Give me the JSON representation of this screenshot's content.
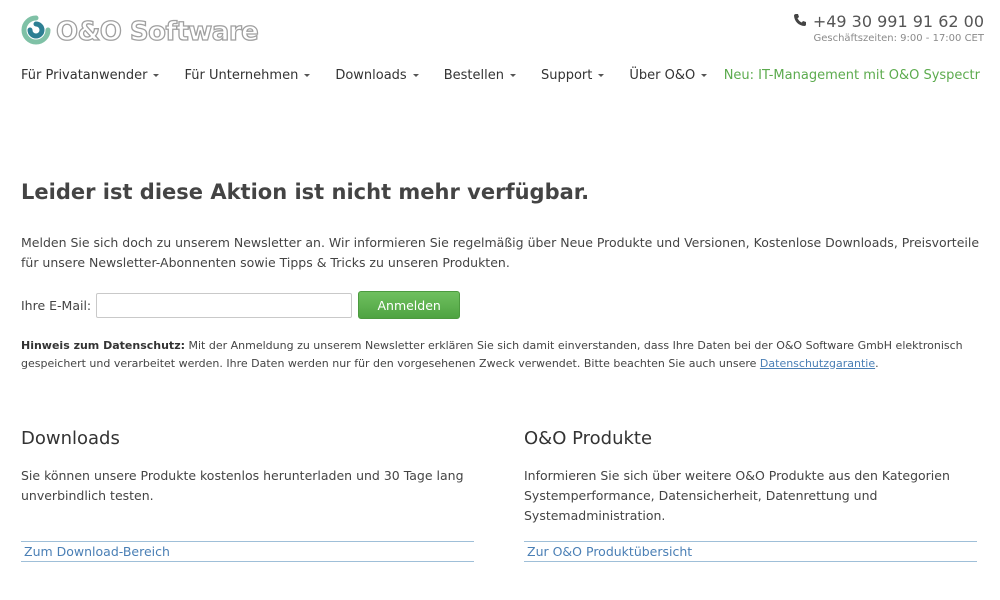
{
  "header": {
    "logo_text": "O&O Software",
    "phone": "+49 30 991 91 62 00",
    "hours": "Geschäftszeiten: 9:00 - 17:00 CET"
  },
  "nav": {
    "items": [
      "Für Privatanwender",
      "Für Unternehmen",
      "Downloads",
      "Bestellen",
      "Support",
      "Über O&O"
    ],
    "promo": "Neu: IT-Management mit O&O Syspectr"
  },
  "main": {
    "headline": "Leider ist diese Aktion ist nicht mehr verfügbar.",
    "intro": "Melden Sie sich doch zu unserem Newsletter an. Wir informieren Sie regelmäßig über Neue Produkte und Versionen, Kostenlose Downloads, Preisvorteile für unsere Newsletter-Abonnenten sowie Tipps & Tricks zu unseren Produkten.",
    "email_label": "Ihre E-Mail:",
    "email_value": "",
    "submit_label": "Anmelden",
    "privacy_title": "Hinweis zum Datenschutz:",
    "privacy_text": " Mit der Anmeldung zu unserem Newsletter erklären Sie sich damit einverstanden, dass Ihre Daten bei der O&O Software GmbH elektronisch gespeichert und verarbeitet werden. Ihre Daten werden nur für den vorgesehenen Zweck verwendet. Bitte beachten Sie auch unsere ",
    "privacy_link": "Datenschutzgarantie",
    "privacy_end": "."
  },
  "columns": {
    "downloads": {
      "title": "Downloads",
      "text": "Sie können unsere Produkte kostenlos herunterladen und 30 Tage lang unverbindlich testen.",
      "link": "Zum Download-Bereich"
    },
    "products": {
      "title": "O&O Produkte",
      "text": "Informieren Sie sich über weitere O&O Produkte aus den Kategorien Systemperformance, Datensicherheit, Datenrettung und Systemadministration.",
      "link": "Zur O&O Produktübersicht"
    }
  },
  "colors": {
    "accent_green": "#5cab4e",
    "link_blue": "#4a7fb5",
    "logo_teal": "#3f8f9a"
  },
  "icons": [
    "logo-swirl-icon",
    "phone-icon",
    "chevron-down-icon"
  ]
}
